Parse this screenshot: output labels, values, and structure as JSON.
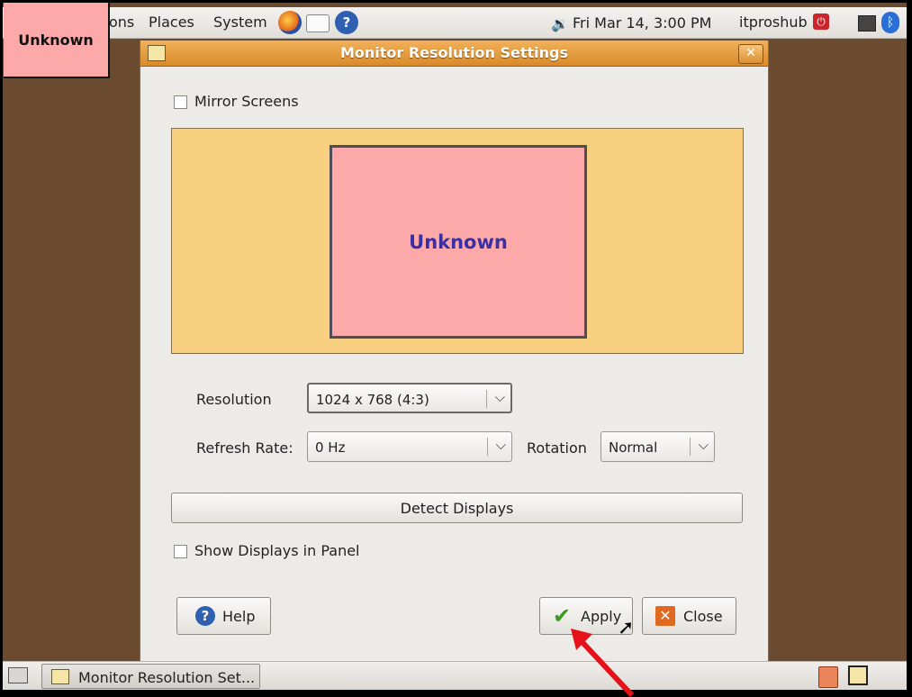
{
  "panel": {
    "menus": [
      "ons",
      "Places",
      "System"
    ],
    "clock": "Fri Mar 14,  3:00 PM",
    "user": "itproshub"
  },
  "overlay_tag": "Unknown",
  "dialog": {
    "title": "Monitor Resolution Settings",
    "mirror_label": "Mirror Screens",
    "monitor_label": "Unknown",
    "resolution_label": "Resolution",
    "resolution_value": "1024 x 768 (4:3)",
    "refresh_label": "Refresh Rate:",
    "refresh_value": "0 Hz",
    "rotation_label": "Rotation",
    "rotation_value": "Normal",
    "detect_label": "Detect Displays",
    "show_panel_label": "Show Displays in Panel",
    "help_label": "Help",
    "apply_label": "Apply",
    "close_label": "Close"
  },
  "taskbar": {
    "window_label": "Monitor Resolution Set..."
  },
  "colors": {
    "accent": "#d88a2a",
    "preview_bg": "#f9d07f",
    "monitor_fill": "#fda9a9",
    "desktop": "#6a4b2f"
  }
}
